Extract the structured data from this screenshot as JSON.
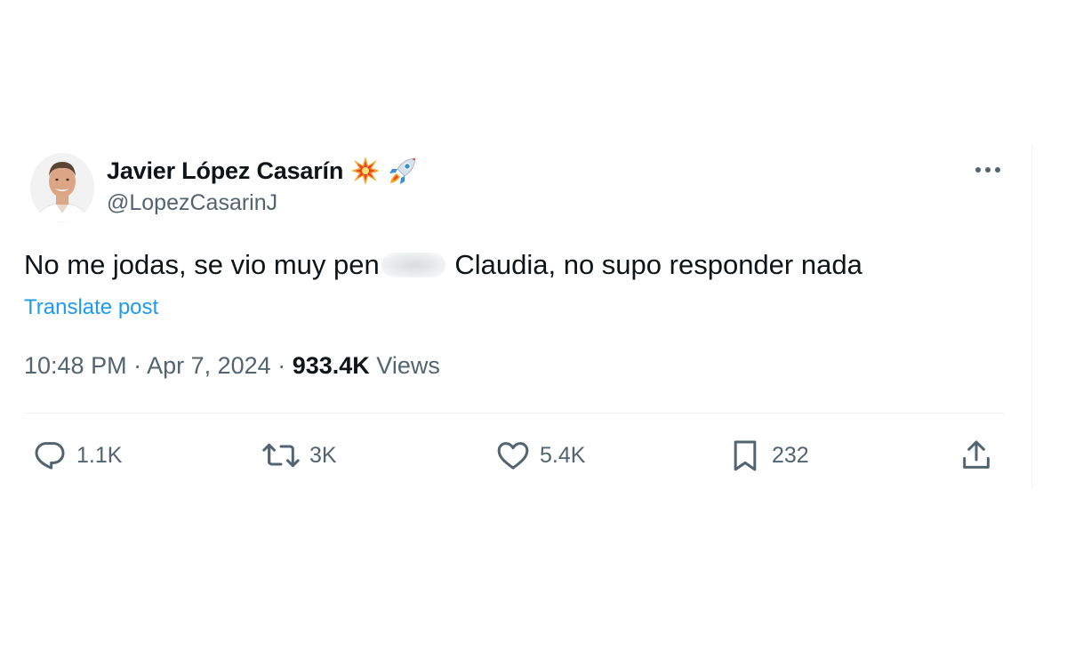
{
  "author": {
    "display_name": "Javier López Casarín",
    "handle": "@LopezCasarinJ",
    "name_emojis": [
      "collision-emoji",
      "rocket-emoji"
    ]
  },
  "tweet": {
    "text_before": "No me jodas, se vio muy pen",
    "text_after": " Claudia, no supo responder nada",
    "translate_label": "Translate post"
  },
  "meta": {
    "time": "10:48 PM",
    "separator": " · ",
    "date": "Apr 7, 2024",
    "views_count": "933.4K",
    "views_label": "Views"
  },
  "actions": {
    "reply_count": "1.1K",
    "repost_count": "3K",
    "like_count": "5.4K",
    "bookmark_count": "232"
  },
  "colors": {
    "text_primary": "#0f1419",
    "text_secondary": "#536471",
    "link": "#1d9bf0",
    "divider": "#eff3f4"
  }
}
